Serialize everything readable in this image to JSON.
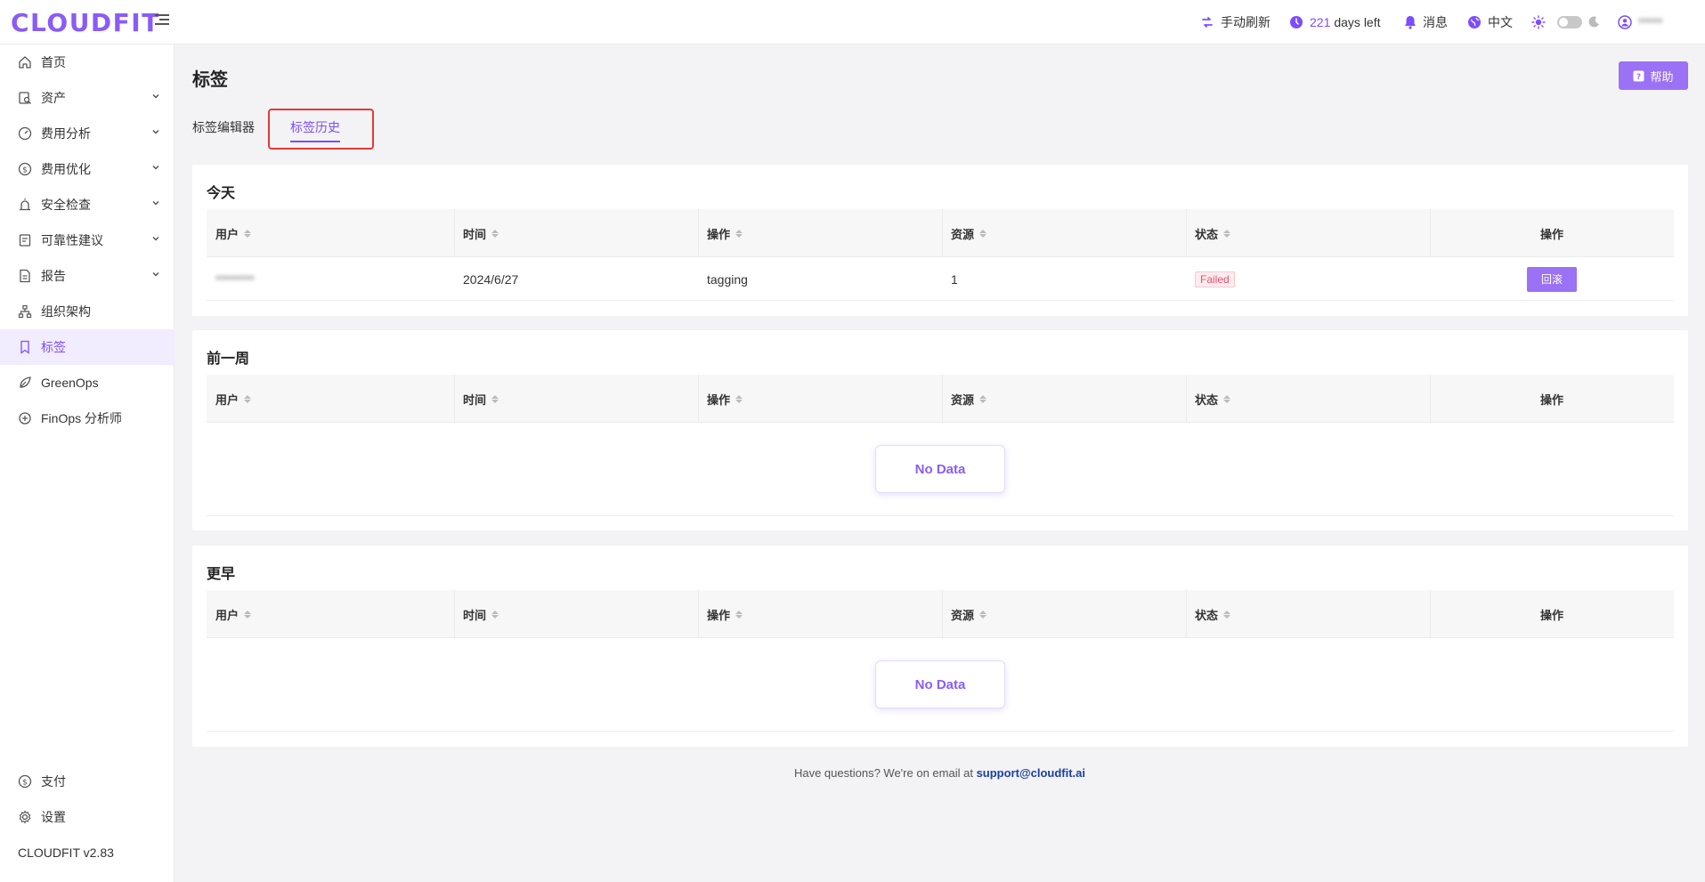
{
  "brand": {
    "logo": "CLOUDFIT",
    "version": "CLOUDFIT v2.83",
    "accent": "#8a5cf6"
  },
  "header": {
    "refresh_label": "手动刷新",
    "days_value": "221",
    "days_suffix": "days left",
    "messages_label": "消息",
    "language_label": "中文",
    "user_name": "*****"
  },
  "sidebar": {
    "items": [
      {
        "label": "首页",
        "icon": "home-icon"
      },
      {
        "label": "资产",
        "icon": "asset-search-icon"
      },
      {
        "label": "费用分析",
        "icon": "gauge-icon"
      },
      {
        "label": "费用优化",
        "icon": "dollar-circle-icon"
      },
      {
        "label": "安全检查",
        "icon": "alarm-icon"
      },
      {
        "label": "可靠性建议",
        "icon": "checklist-icon"
      },
      {
        "label": "报告",
        "icon": "report-icon"
      },
      {
        "label": "组织架构",
        "icon": "org-chart-icon"
      },
      {
        "label": "标签",
        "icon": "tag-icon"
      },
      {
        "label": "GreenOps",
        "icon": "leaf-icon"
      },
      {
        "label": "FinOps 分析师",
        "icon": "analyst-icon"
      }
    ],
    "bottom": [
      {
        "label": "支付",
        "icon": "payment-icon"
      },
      {
        "label": "设置",
        "icon": "gear-icon"
      }
    ]
  },
  "page": {
    "title": "标签",
    "help_label": "帮助",
    "tabs": [
      {
        "label": "标签编辑器"
      },
      {
        "label": "标签历史"
      }
    ]
  },
  "columns": [
    "用户",
    "时间",
    "操作",
    "资源",
    "状态",
    "操作"
  ],
  "sections": [
    {
      "title": "今天",
      "rows": [
        {
          "user": "********",
          "time": "2024/6/27",
          "operation": "tagging",
          "resource": "1",
          "status": "Failed",
          "action": "回滚"
        }
      ]
    },
    {
      "title": "前一周",
      "empty_label": "No Data"
    },
    {
      "title": "更早",
      "empty_label": "No Data"
    }
  ],
  "footer": {
    "text": "Have questions? We're on email at",
    "email": "support@cloudfit.ai"
  }
}
